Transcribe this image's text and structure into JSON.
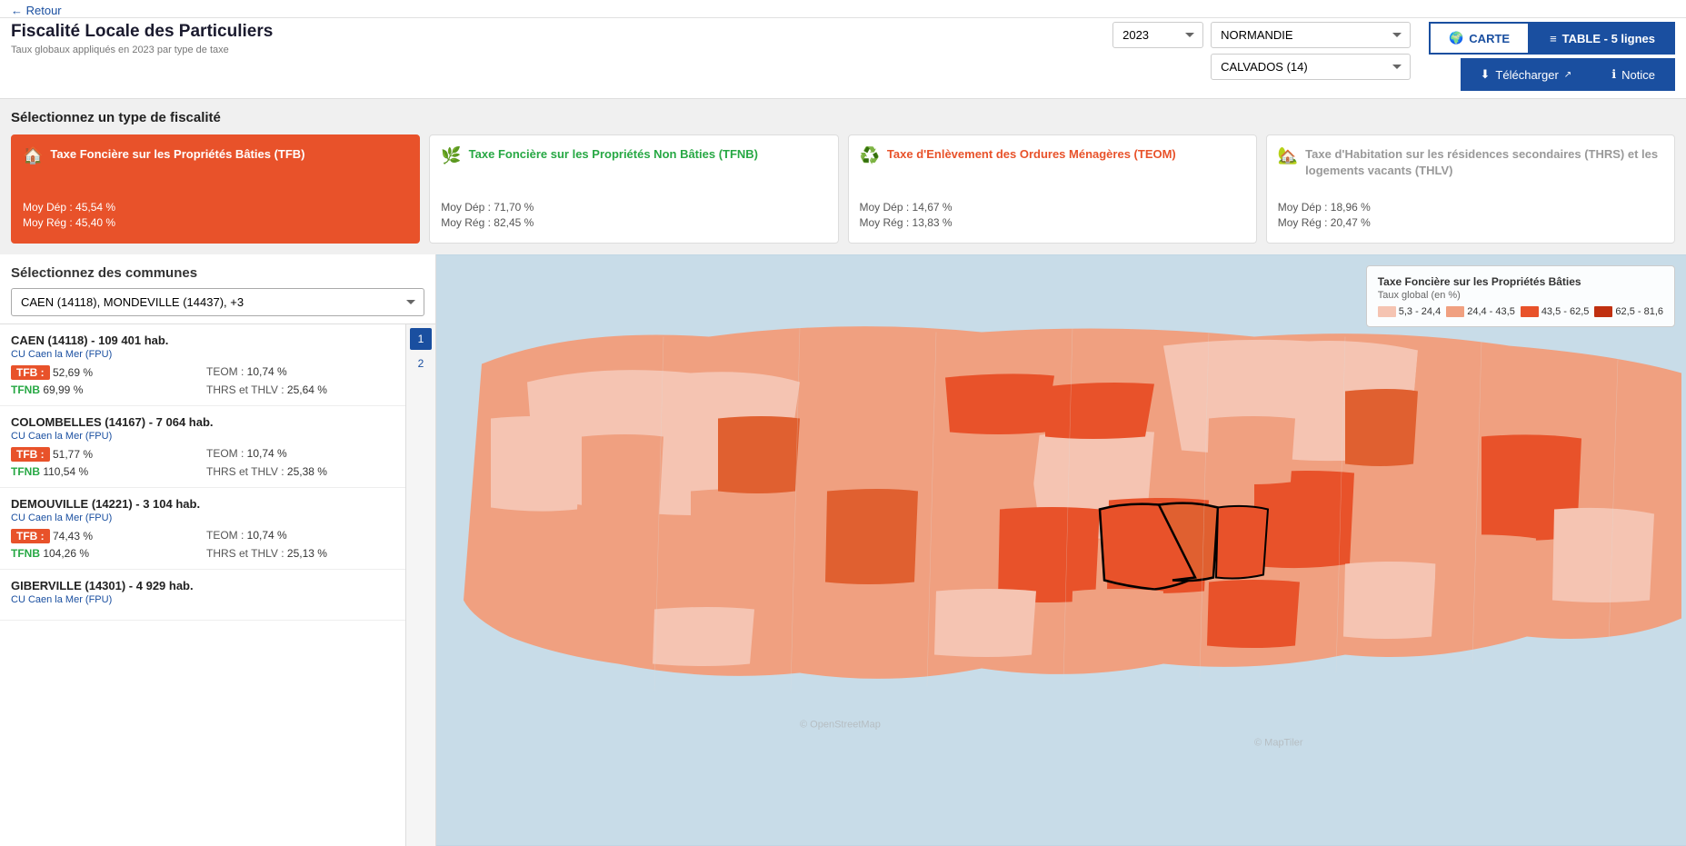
{
  "nav": {
    "back_label": "← Retour"
  },
  "header": {
    "title": "Fiscalité Locale des Particuliers",
    "subtitle": "Taux globaux appliqués en 2023 par type de taxe"
  },
  "controls": {
    "year": "2023",
    "region": "NORMANDIE",
    "departement": "CALVADOS (14)"
  },
  "buttons": {
    "carte_label": "CARTE",
    "table_label": "TABLE - 5 lignes",
    "download_label": "Télécharger",
    "notice_label": "Notice"
  },
  "fiscalite": {
    "section_title": "Sélectionnez un type de fiscalité",
    "cards": [
      {
        "id": "tfb",
        "icon": "🏠",
        "label": "Taxe Foncière sur les Propriétés Bâties (TFB)",
        "moy_dep": "Moy Dép : 45,54 %",
        "moy_reg": "Moy Rég : 45,40 %",
        "active": true
      },
      {
        "id": "tfnb",
        "icon": "🌿",
        "label": "Taxe Foncière sur les Propriétés Non Bâties (TFNB)",
        "moy_dep": "Moy Dép : 71,70 %",
        "moy_reg": "Moy Rég : 82,45 %",
        "active": false
      },
      {
        "id": "teom",
        "icon": "♻️",
        "label": "Taxe d'Enlèvement des Ordures Ménagères (TEOM)",
        "moy_dep": "Moy Dép : 14,67 %",
        "moy_reg": "Moy Rég : 13,83 %",
        "active": false
      },
      {
        "id": "thrs",
        "icon": "🏡",
        "label": "Taxe d'Habitation sur les résidences secondaires (THRS) et les logements vacants (THLV)",
        "moy_dep": "Moy Dép : 18,96 %",
        "moy_reg": "Moy Rég : 20,47 %",
        "active": false
      }
    ]
  },
  "communes": {
    "section_title": "Sélectionnez des communes",
    "dropdown_value": "CAEN (14118), MONDEVILLE (14437), +3",
    "list": [
      {
        "name": "CAEN (14118) - 109 401 hab.",
        "group": "CU Caen la Mer (FPU)",
        "tfb": "52,69 %",
        "tfnb": "69,99 %",
        "teom": "10,74 %",
        "thrs": "25,64 %"
      },
      {
        "name": "COLOMBELLES (14167) - 7 064 hab.",
        "group": "CU Caen la Mer (FPU)",
        "tfb": "51,77 %",
        "tfnb": "110,54 %",
        "teom": "10,74 %",
        "thrs": "25,38 %"
      },
      {
        "name": "DEMOUVILLE (14221) - 3 104 hab.",
        "group": "CU Caen la Mer (FPU)",
        "tfb": "74,43 %",
        "tfnb": "104,26 %",
        "teom": "10,74 %",
        "thrs": "25,13 %"
      },
      {
        "name": "GIBERVILLE (14301) - 4 929 hab.",
        "group": "CU Caen la Mer (FPU)",
        "tfb": "",
        "tfnb": "",
        "teom": "",
        "thrs": ""
      }
    ],
    "pages": [
      "1",
      "2"
    ]
  },
  "legend": {
    "title": "Taxe Foncière sur les Propriétés Bâties",
    "subtitle": "Taux global (en %)",
    "ranges": [
      {
        "label": "5,3 - 24,4",
        "color": "#f5c4b2"
      },
      {
        "label": "24,4 - 43,5",
        "color": "#f0a080"
      },
      {
        "label": "43,5 - 62,5",
        "color": "#e8522a"
      },
      {
        "label": "62,5 - 81,6",
        "color": "#c03010"
      }
    ]
  }
}
